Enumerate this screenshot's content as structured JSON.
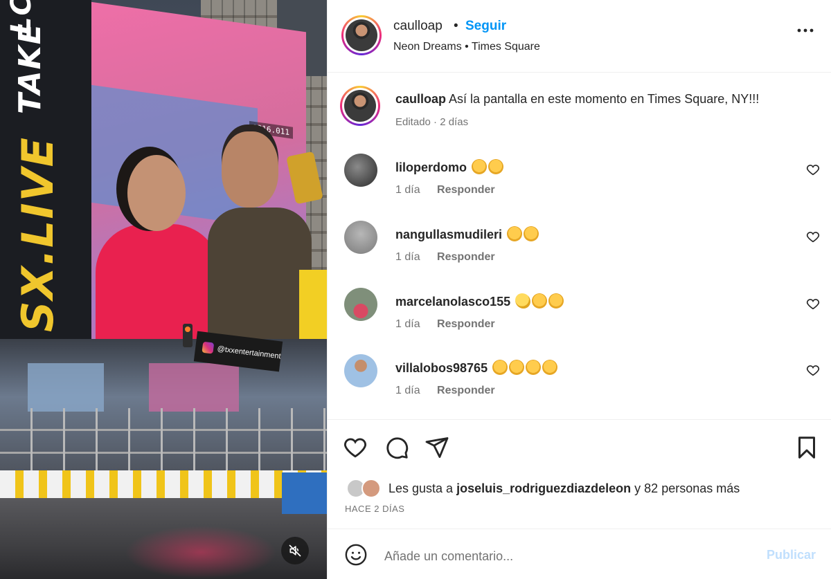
{
  "media": {
    "billboard_left_texts": [
      "SX.LIVE",
      "TAKE",
      "LCR"
    ],
    "screen_timecode": "1216.011",
    "instagram_sign_handle": "@txxentertainment",
    "mute_icon": "speaker-muted-icon"
  },
  "header": {
    "username": "caulloap",
    "separator": "•",
    "follow_label": "Seguir",
    "subline": "Neon Dreams • Times Square",
    "more_icon": "more-horizontal-icon"
  },
  "caption": {
    "username": "caulloap",
    "text": "Así la pantalla en este momento en Times Square, NY!!!",
    "meta": "Editado · 2 días"
  },
  "comments": [
    {
      "username": "liloperdomo",
      "emojis": [
        "raising-hands",
        "raising-hands"
      ],
      "time": "1 día",
      "reply_label": "Responder"
    },
    {
      "username": "nangullasmudileri",
      "emojis": [
        "raising-hands",
        "raising-hands"
      ],
      "time": "1 día",
      "reply_label": "Responder"
    },
    {
      "username": "marcelanolasco155",
      "emojis": [
        "clapping-hands",
        "raising-hands",
        "raising-hands"
      ],
      "time": "1 día",
      "reply_label": "Responder"
    },
    {
      "username": "villalobos98765",
      "emojis": [
        "raising-hands",
        "raising-hands",
        "raising-hands",
        "raising-hands"
      ],
      "time": "1 día",
      "reply_label": "Responder"
    }
  ],
  "likes": {
    "prefix": "Les gusta a",
    "user": "joseluis_rodriguezdiazdeleon",
    "suffix": "y 82 personas más",
    "time_ago": "HACE 2 DÍAS"
  },
  "add_comment": {
    "placeholder": "Añade un comentario...",
    "publish_label": "Publicar"
  },
  "colors": {
    "accent_blue": "#0095f6",
    "publish_disabled": "#c0dffd",
    "secondary_text": "#737373",
    "emoji_yellow": "#ffcc4d"
  }
}
